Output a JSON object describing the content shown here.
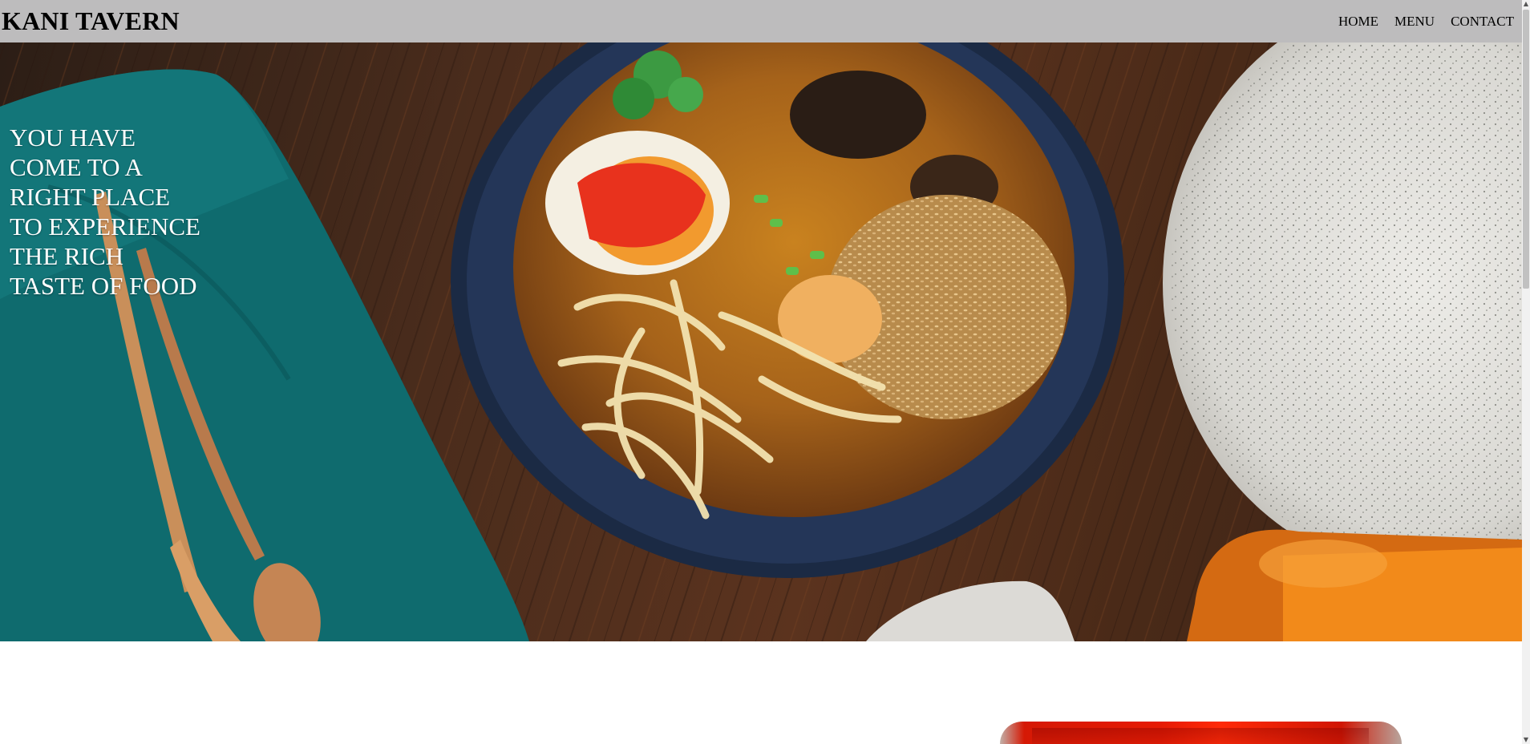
{
  "header": {
    "brand": "KANI TAVERN",
    "nav": [
      {
        "label": "HOME"
      },
      {
        "label": "MENU"
      },
      {
        "label": "CONTACT"
      }
    ]
  },
  "hero": {
    "headline_lines": [
      "YOU HAVE",
      "COME TO A",
      "RIGHT PLACE",
      "TO EXPERIENCE",
      "THE RICH",
      "TASTE OF FOOD"
    ]
  },
  "colors": {
    "header_bg": "#bdbcbd",
    "headline_text": "#ffffff"
  }
}
